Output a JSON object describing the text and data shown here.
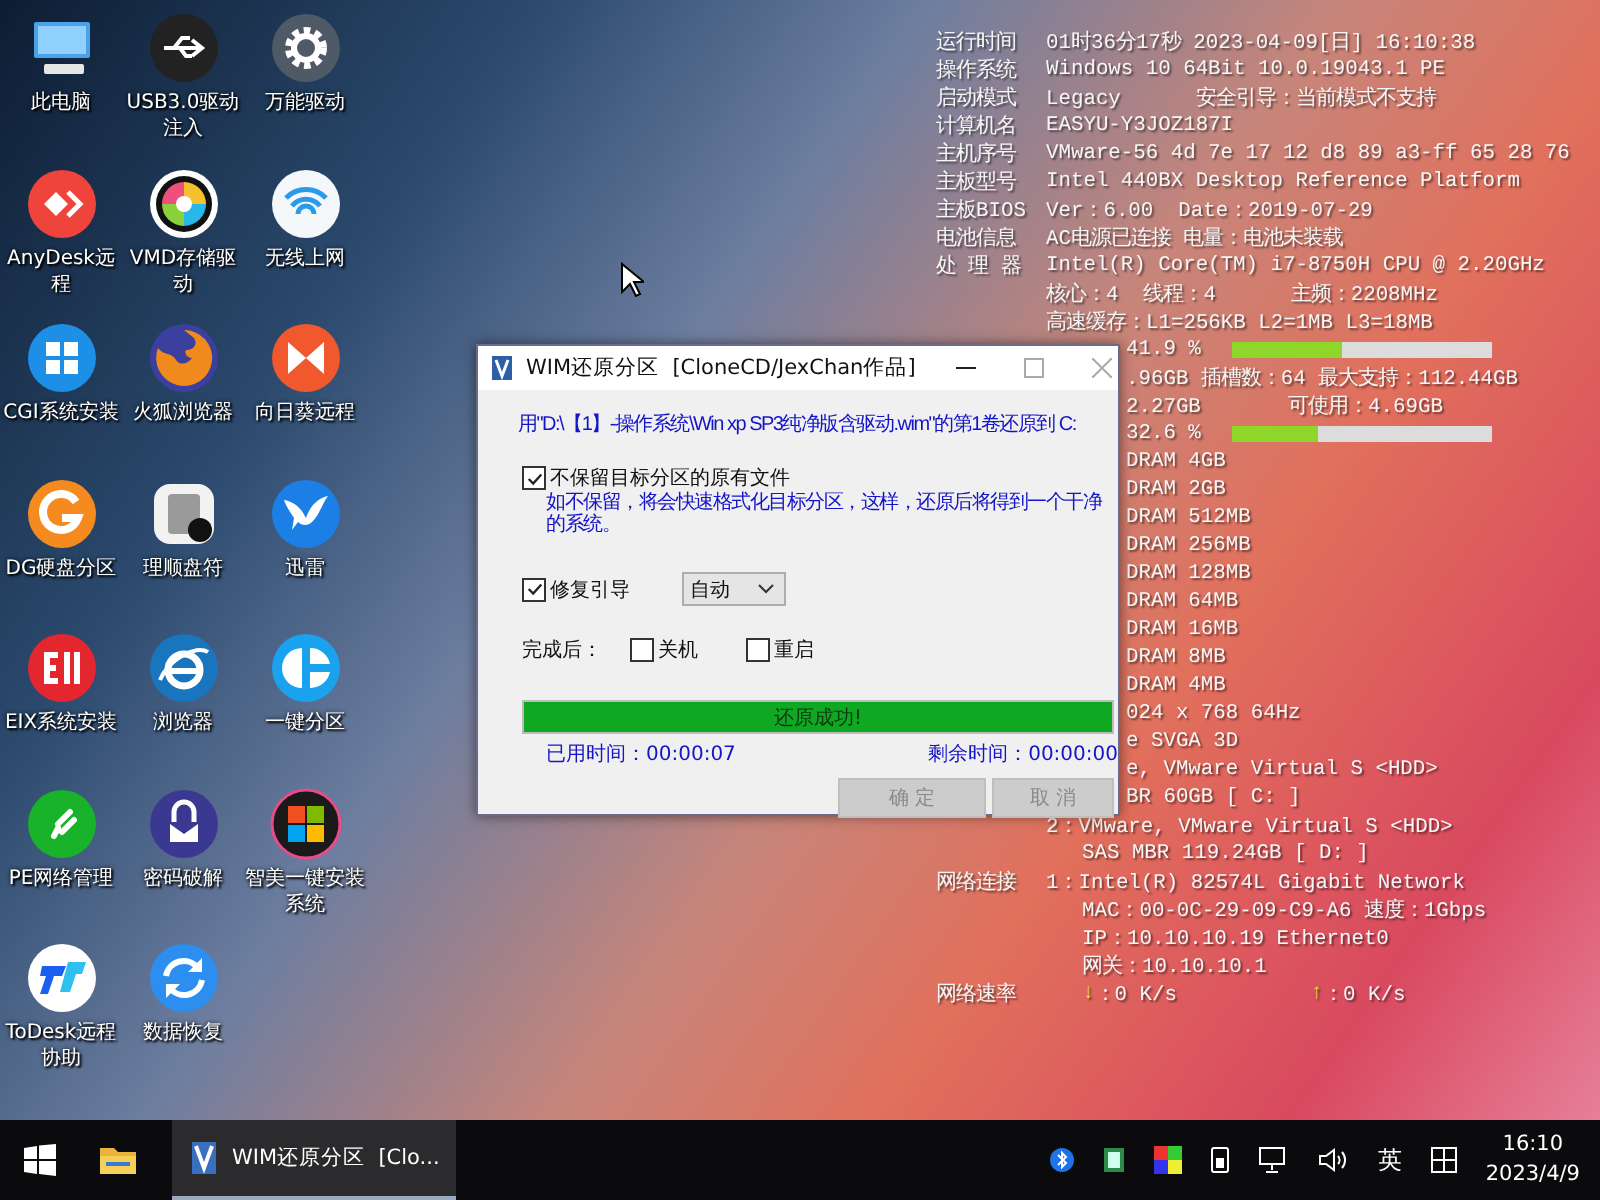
{
  "desktop": {
    "icons": [
      {
        "label": "此电脑"
      },
      {
        "label": "USB3.0驱动注入"
      },
      {
        "label": "万能驱动"
      },
      {
        "label": "AnyDesk远程"
      },
      {
        "label": "VMD存储驱动"
      },
      {
        "label": "无线上网"
      },
      {
        "label": "CGI系统安装"
      },
      {
        "label": "火狐浏览器"
      },
      {
        "label": "向日葵远程"
      },
      {
        "label": "DG硬盘分区"
      },
      {
        "label": "理顺盘符"
      },
      {
        "label": "迅雷"
      },
      {
        "label": "EIX系统安装"
      },
      {
        "label": "浏览器"
      },
      {
        "label": "一键分区"
      },
      {
        "label": "PE网络管理"
      },
      {
        "label": "密码破解"
      },
      {
        "label": "智美一键安装系统"
      },
      {
        "label": "ToDesk远程协助"
      },
      {
        "label": "数据恢复"
      }
    ]
  },
  "info_panel": {
    "rows": [
      {
        "kind": "labeled",
        "label": "运行时间",
        "value": "01时36分17秒 2023-04-09[日] 16:10:38"
      },
      {
        "kind": "labeled",
        "label": "操作系统",
        "value": "Windows 10 64Bit 10.0.19043.1 PE"
      },
      {
        "kind": "labeled",
        "label": "启动模式",
        "value": "Legacy      安全引导：当前模式不支持"
      },
      {
        "kind": "labeled",
        "label": "计算机名",
        "value": "EASYU-Y3JOZ187I"
      },
      {
        "kind": "labeled",
        "label": "主机序号",
        "value": "VMware-56 4d 7e 17 12 d8 89 a3-ff 65 28 76"
      },
      {
        "kind": "labeled",
        "label": "主板型号",
        "value": "Intel 440BX Desktop Reference Platform"
      },
      {
        "kind": "labeled",
        "label": "主板BIOS",
        "value": "Ver：6.00  Date：2019-07-29"
      },
      {
        "kind": "labeled",
        "label": "电池信息",
        "value": "AC电源已连接 电量：电池未装载"
      },
      {
        "kind": "labeled",
        "label": "处 理 器",
        "value": "Intel(R) Core(TM) i7-8750H CPU @ 2.20GHz"
      },
      {
        "kind": "labeled",
        "value": "核心：4  线程：4      主频：2208MHz"
      },
      {
        "kind": "labeled",
        "value": "高速缓存：L1=256KB L2=1MB L3=18MB"
      },
      {
        "kind": "meter",
        "value": "41.9 %",
        "level": 0.42
      },
      {
        "kind": "covered",
        "value": ".96GB 插槽数：64 最大支持：112.44GB"
      },
      {
        "kind": "covered",
        "value": "2.27GB       可使用：4.69GB"
      },
      {
        "kind": "meter",
        "value": "32.6 %",
        "level": 0.33
      },
      {
        "kind": "covered",
        "value": "DRAM 4GB"
      },
      {
        "kind": "covered",
        "value": "DRAM 2GB"
      },
      {
        "kind": "covered",
        "value": "DRAM 512MB"
      },
      {
        "kind": "covered",
        "value": "DRAM 256MB"
      },
      {
        "kind": "covered",
        "value": "DRAM 128MB"
      },
      {
        "kind": "covered",
        "value": "DRAM 64MB"
      },
      {
        "kind": "covered",
        "value": "DRAM 16MB"
      },
      {
        "kind": "covered",
        "value": "DRAM 8MB"
      },
      {
        "kind": "covered",
        "value": "DRAM 4MB"
      },
      {
        "kind": "covered",
        "value": "024 x 768 64Hz"
      },
      {
        "kind": "covered",
        "value": "e SVGA 3D"
      },
      {
        "kind": "covered",
        "value": "e, VMware Virtual S <HDD>"
      },
      {
        "kind": "covered",
        "value": "BR 60GB [ C: ]"
      },
      {
        "kind": "labeled",
        "value": "2：VMware, VMware Virtual S <HDD>"
      },
      {
        "kind": "sub",
        "value": "SAS MBR 119.24GB [ D: ]"
      },
      {
        "kind": "labeled",
        "label": "网络连接",
        "value": "1：Intel(R) 82574L Gigabit Network"
      },
      {
        "kind": "sub",
        "value": "MAC：00-0C-29-09-C9-A6 速度：1Gbps"
      },
      {
        "kind": "sub",
        "value": "IP：10.10.10.19 Ethernet0"
      },
      {
        "kind": "sub",
        "value": "网关：10.10.10.1"
      },
      {
        "kind": "speed",
        "label": "网络速率",
        "down_arrow": "↓",
        "down": "：0 K/s",
        "up_arrow": "↑",
        "up": "：0 K/s"
      }
    ]
  },
  "dialog": {
    "title": "WIM还原分区  [CloneCD/JexChan作品]",
    "message": "用\"D:\\【1】-操作系统\\Win xp SP3纯净版含驱动.wim\"的第1卷还原到 C:",
    "keep_files": {
      "label": "不保留目标分区的原有文件",
      "checked": true
    },
    "note": "如不保留，将会快速格式化目标分区，这样，还原后将得到一个干净的系统。",
    "fix_boot": {
      "label": "修复引导",
      "checked": true
    },
    "boot_mode": {
      "value": "自动"
    },
    "after_label": "完成后：",
    "after_options": [
      {
        "label": "关机",
        "checked": false
      },
      {
        "label": "重启",
        "checked": false
      }
    ],
    "progress": {
      "level": 1,
      "text": "还原成功!"
    },
    "elapsed": "已用时间：00:00:07",
    "remaining": "剩余时间：00:00:00",
    "buttons": [
      {
        "label": "确 定",
        "disabled": true
      },
      {
        "label": "取 消",
        "disabled": true
      }
    ]
  },
  "taskbar": {
    "task": {
      "label": "WIM还原分区  [Clo...",
      "selected": true
    },
    "ime": "英",
    "time": "16:10",
    "date": "2023/4/9"
  }
}
